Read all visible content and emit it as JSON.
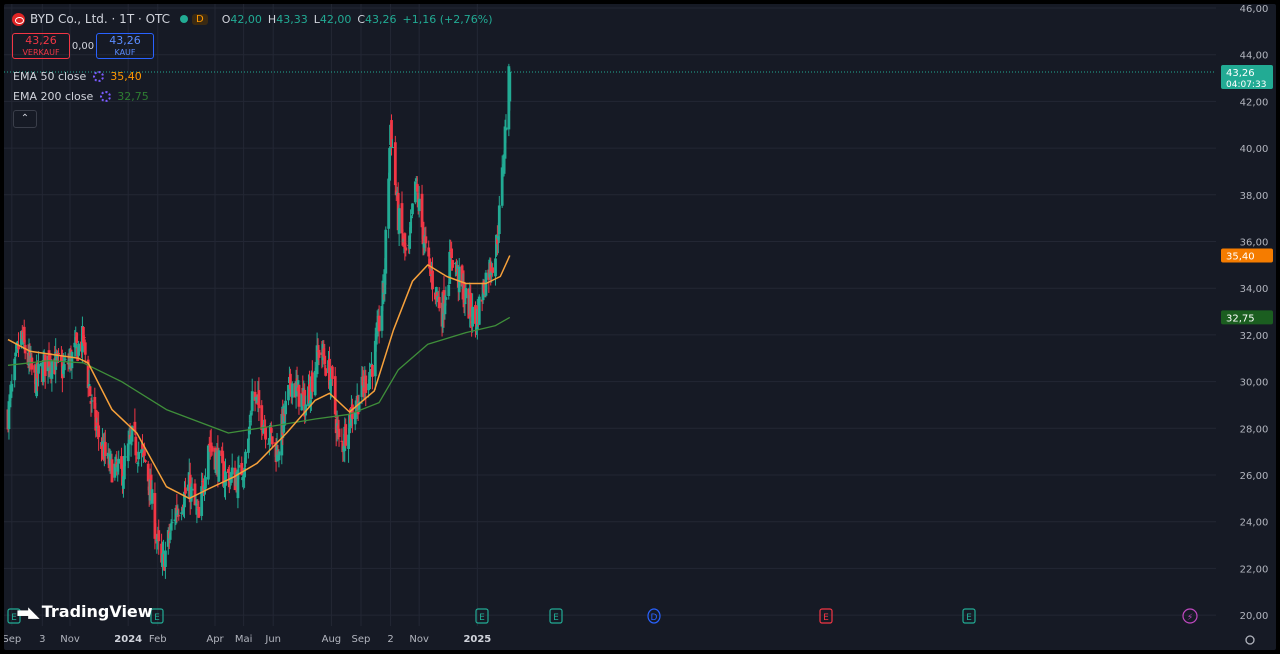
{
  "header": {
    "title": "BYD Co., Ltd. · 1T · OTC",
    "interval_badge": "D",
    "ohlc": [
      {
        "k": "O",
        "v": "42,00"
      },
      {
        "k": "H",
        "v": "43,33"
      },
      {
        "k": "L",
        "v": "42,00"
      },
      {
        "k": "C",
        "v": "43,26"
      }
    ],
    "change": "+1,16 (+2,76%)",
    "sell_price": "43,26",
    "sell_label": "VERKAUF",
    "spread": "0,00",
    "buy_price": "43,26",
    "buy_label": "KAUF"
  },
  "indicators": [
    {
      "label": "EMA 50 close",
      "value": "35,40",
      "color": "#ff9800"
    },
    {
      "label": "EMA 200 close",
      "value": "32,75",
      "color": "#2e7d32"
    }
  ],
  "collapse_glyph": "⌃",
  "branding": "TradingView",
  "colors": {
    "up": "#22ab94",
    "down": "#f23645",
    "ema50": "#f7a13b",
    "ema200": "#3f8f3a",
    "grid": "#232734",
    "text": "#b2b5be",
    "bg": "#161a25"
  },
  "chart_data": {
    "type": "candlestick",
    "ylim": [
      20,
      46
    ],
    "yticks": [
      "46,00",
      "44,00",
      "42,00",
      "40,00",
      "38,00",
      "36,00",
      "34,00",
      "32,00",
      "30,00",
      "28,00",
      "26,00",
      "24,00",
      "22,00",
      "20,00"
    ],
    "xticks": [
      "Sep",
      "3",
      "Nov",
      "2024",
      "Feb",
      "Apr",
      "Mai",
      "Jun",
      "Aug",
      "Sep",
      "2",
      "Nov",
      "2025"
    ],
    "price_label": {
      "value": "43,26",
      "countdown": "04:07:33"
    },
    "ema50_label": "35,40",
    "ema200_label": "32,75",
    "event_markers": [
      "E",
      "E",
      "E",
      "E",
      "D",
      "E",
      "E",
      "⚡"
    ],
    "ohlc_anchors": [
      [
        "2023-08-28",
        28.6
      ],
      [
        "2023-09-10",
        32.0
      ],
      [
        "2023-09-25",
        30.0
      ],
      [
        "2023-10-10",
        31.0
      ],
      [
        "2023-10-25",
        30.5
      ],
      [
        "2023-11-15",
        31.8
      ],
      [
        "2023-11-25",
        28.5
      ],
      [
        "2023-12-10",
        26.5
      ],
      [
        "2023-12-25",
        26.0
      ],
      [
        "2024-01-05",
        27.5
      ],
      [
        "2024-01-20",
        26.5
      ],
      [
        "2024-02-01",
        23.0
      ],
      [
        "2024-02-05",
        22.0
      ],
      [
        "2024-02-20",
        24.5
      ],
      [
        "2024-03-05",
        25.5
      ],
      [
        "2024-03-15",
        24.0
      ],
      [
        "2024-03-25",
        27.5
      ],
      [
        "2024-04-10",
        26.0
      ],
      [
        "2024-04-25",
        25.8
      ],
      [
        "2024-05-05",
        27.0
      ],
      [
        "2024-05-10",
        29.5
      ],
      [
        "2024-05-25",
        28.0
      ],
      [
        "2024-06-05",
        27.0
      ],
      [
        "2024-06-20",
        30.0
      ],
      [
        "2024-07-05",
        29.0
      ],
      [
        "2024-07-20",
        31.5
      ],
      [
        "2024-08-01",
        30.0
      ],
      [
        "2024-08-10",
        27.0
      ],
      [
        "2024-08-20",
        28.5
      ],
      [
        "2024-09-01",
        29.5
      ],
      [
        "2024-09-15",
        31.0
      ],
      [
        "2024-09-25",
        34.0
      ],
      [
        "2024-10-02",
        41.0
      ],
      [
        "2024-10-10",
        37.0
      ],
      [
        "2024-10-20",
        35.0
      ],
      [
        "2024-10-28",
        38.5
      ],
      [
        "2024-11-10",
        35.0
      ],
      [
        "2024-11-25",
        33.0
      ],
      [
        "2024-12-05",
        35.5
      ],
      [
        "2024-12-15",
        34.0
      ],
      [
        "2024-12-30",
        32.5
      ],
      [
        "2025-01-10",
        34.5
      ],
      [
        "2025-01-20",
        35.5
      ],
      [
        "2025-01-25",
        37.5
      ],
      [
        "2025-02-02",
        42.5
      ],
      [
        "2025-02-04",
        43.26
      ]
    ],
    "ema50_anchors": [
      [
        "2023-08-28",
        31.8
      ],
      [
        "2023-09-20",
        31.3
      ],
      [
        "2023-11-10",
        31.0
      ],
      [
        "2023-11-20",
        30.8
      ],
      [
        "2023-12-15",
        28.8
      ],
      [
        "2024-01-10",
        27.8
      ],
      [
        "2024-02-10",
        25.5
      ],
      [
        "2024-03-05",
        25.0
      ],
      [
        "2024-03-25",
        25.4
      ],
      [
        "2024-04-20",
        25.9
      ],
      [
        "2024-05-15",
        26.5
      ],
      [
        "2024-06-15",
        27.8
      ],
      [
        "2024-07-15",
        29.2
      ],
      [
        "2024-07-30",
        29.5
      ],
      [
        "2024-08-20",
        28.7
      ],
      [
        "2024-09-15",
        29.6
      ],
      [
        "2024-10-05",
        32.2
      ],
      [
        "2024-10-25",
        34.3
      ],
      [
        "2024-11-10",
        35.0
      ],
      [
        "2024-11-30",
        34.5
      ],
      [
        "2024-12-20",
        34.2
      ],
      [
        "2025-01-10",
        34.2
      ],
      [
        "2025-01-25",
        34.5
      ],
      [
        "2025-02-04",
        35.4
      ]
    ],
    "ema200_anchors": [
      [
        "2023-08-28",
        30.7
      ],
      [
        "2023-10-10",
        30.9
      ],
      [
        "2023-11-15",
        30.8
      ],
      [
        "2023-12-25",
        30.0
      ],
      [
        "2024-02-10",
        28.8
      ],
      [
        "2024-04-15",
        27.8
      ],
      [
        "2024-06-01",
        28.1
      ],
      [
        "2024-07-15",
        28.4
      ],
      [
        "2024-08-20",
        28.6
      ],
      [
        "2024-09-20",
        29.1
      ],
      [
        "2024-10-10",
        30.5
      ],
      [
        "2024-11-10",
        31.6
      ],
      [
        "2024-12-20",
        32.1
      ],
      [
        "2025-01-20",
        32.4
      ],
      [
        "2025-02-04",
        32.75
      ]
    ]
  }
}
